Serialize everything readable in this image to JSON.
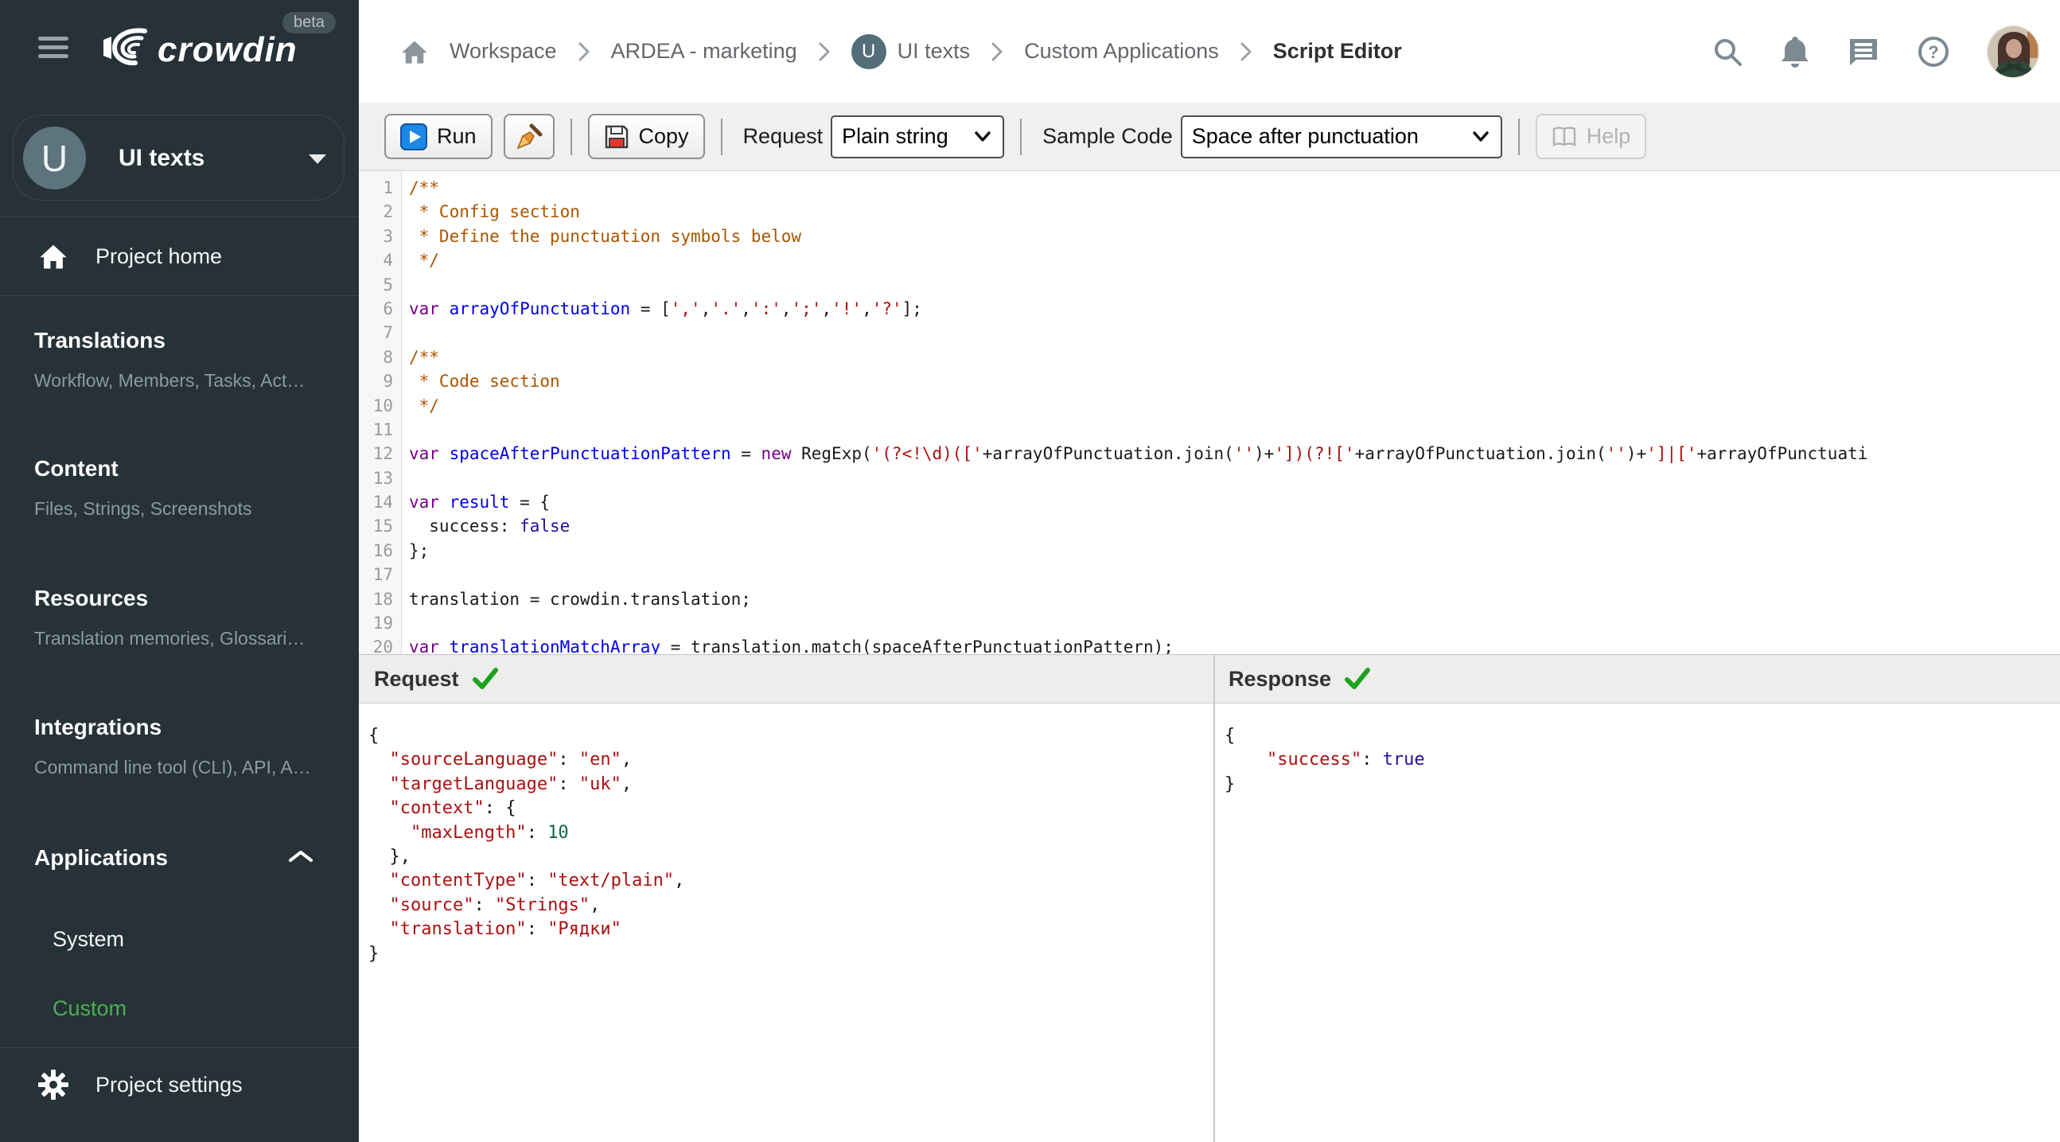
{
  "sidebar": {
    "logo_text": "crowdin",
    "beta_label": "beta",
    "project": {
      "initial": "U",
      "name": "UI texts"
    },
    "home_label": "Project home",
    "sections": [
      {
        "title": "Translations",
        "subtitle": "Workflow, Members, Tasks, Act…"
      },
      {
        "title": "Content",
        "subtitle": "Files, Strings, Screenshots"
      },
      {
        "title": "Resources",
        "subtitle": "Translation memories, Glossari…"
      },
      {
        "title": "Integrations",
        "subtitle": "Command line tool (CLI), API, A…"
      }
    ],
    "applications": {
      "title": "Applications",
      "items": [
        {
          "label": "System",
          "active": false
        },
        {
          "label": "Custom",
          "active": true
        }
      ]
    },
    "settings_label": "Project settings",
    "active_color": "#4caf50"
  },
  "breadcrumb": {
    "project_initial": "U",
    "items": [
      "Workspace",
      "ARDEA - marketing",
      "UI texts",
      "Custom Applications",
      "Script Editor"
    ]
  },
  "toolbar": {
    "run_label": "Run",
    "copy_label": "Copy",
    "request_label": "Request",
    "request_value": "Plain string",
    "sample_code_label": "Sample Code",
    "sample_code_value": "Space after punctuation",
    "help_label": "Help"
  },
  "editor": {
    "lines": [
      [
        [
          "c",
          "/**"
        ]
      ],
      [
        [
          "c",
          " * Config section"
        ]
      ],
      [
        [
          "c",
          " * Define the punctuation symbols below"
        ]
      ],
      [
        [
          "c",
          " */"
        ]
      ],
      [],
      [
        [
          "k",
          "var"
        ],
        [
          "p",
          " "
        ],
        [
          "d",
          "arrayOfPunctuation"
        ],
        [
          "p",
          " = ["
        ],
        [
          "s",
          "','"
        ],
        [
          "p",
          ","
        ],
        [
          "s",
          "'.'"
        ],
        [
          "p",
          ","
        ],
        [
          "s",
          "':'"
        ],
        [
          "p",
          ","
        ],
        [
          "s",
          "';'"
        ],
        [
          "p",
          ","
        ],
        [
          "s",
          "'!'"
        ],
        [
          "p",
          ","
        ],
        [
          "s",
          "'?'"
        ],
        [
          "p",
          "];"
        ]
      ],
      [],
      [
        [
          "c",
          "/**"
        ]
      ],
      [
        [
          "c",
          " * Code section"
        ]
      ],
      [
        [
          "c",
          " */"
        ]
      ],
      [],
      [
        [
          "k",
          "var"
        ],
        [
          "p",
          " "
        ],
        [
          "d",
          "spaceAfterPunctuationPattern"
        ],
        [
          "p",
          " = "
        ],
        [
          "k",
          "new"
        ],
        [
          "p",
          " RegExp("
        ],
        [
          "s",
          "'(?<!\\d)(['"
        ],
        [
          "p",
          "+arrayOfPunctuation.join("
        ],
        [
          "s",
          "''"
        ],
        [
          "p",
          ")+"
        ],
        [
          "s",
          "'])(?!['"
        ],
        [
          "p",
          "+arrayOfPunctuation.join("
        ],
        [
          "s",
          "''"
        ],
        [
          "p",
          ")+"
        ],
        [
          "s",
          "']|['"
        ],
        [
          "p",
          "+arrayOfPunctuati"
        ]
      ],
      [],
      [
        [
          "k",
          "var"
        ],
        [
          "p",
          " "
        ],
        [
          "d",
          "result"
        ],
        [
          "p",
          " = {"
        ]
      ],
      [
        [
          "p",
          "  success: "
        ],
        [
          "a",
          "false"
        ]
      ],
      [
        [
          "p",
          "};"
        ]
      ],
      [],
      [
        [
          "p",
          "translation = crowdin.translation;"
        ]
      ],
      [],
      [
        [
          "k",
          "var"
        ],
        [
          "p",
          " "
        ],
        [
          "d",
          "translationMatchArray"
        ],
        [
          "p",
          " = translation.match(spaceAfterPunctuationPattern);"
        ]
      ],
      []
    ]
  },
  "request_panel": {
    "title": "Request",
    "status": "success",
    "lines": [
      [
        [
          "p",
          "{"
        ]
      ],
      [
        [
          "s",
          "  \"sourceLanguage\""
        ],
        [
          "p",
          ": "
        ],
        [
          "s",
          "\"en\""
        ],
        [
          "p",
          ","
        ]
      ],
      [
        [
          "s",
          "  \"targetLanguage\""
        ],
        [
          "p",
          ": "
        ],
        [
          "s",
          "\"uk\""
        ],
        [
          "p",
          ","
        ]
      ],
      [
        [
          "s",
          "  \"context\""
        ],
        [
          "p",
          ": {"
        ]
      ],
      [
        [
          "s",
          "    \"maxLength\""
        ],
        [
          "p",
          ": "
        ],
        [
          "n",
          "10"
        ]
      ],
      [
        [
          "p",
          "  },"
        ]
      ],
      [
        [
          "s",
          "  \"contentType\""
        ],
        [
          "p",
          ": "
        ],
        [
          "s",
          "\"text/plain\""
        ],
        [
          "p",
          ","
        ]
      ],
      [
        [
          "s",
          "  \"source\""
        ],
        [
          "p",
          ": "
        ],
        [
          "s",
          "\"Strings\""
        ],
        [
          "p",
          ","
        ]
      ],
      [
        [
          "s",
          "  \"translation\""
        ],
        [
          "p",
          ": "
        ],
        [
          "s",
          "\"Рядки\""
        ]
      ],
      [
        [
          "p",
          "}"
        ]
      ]
    ]
  },
  "response_panel": {
    "title": "Response",
    "status": "success",
    "lines": [
      [
        [
          "p",
          "{"
        ]
      ],
      [
        [
          "s",
          "    \"success\""
        ],
        [
          "p",
          ": "
        ],
        [
          "a",
          "true"
        ]
      ],
      [
        [
          "p",
          "}"
        ]
      ]
    ]
  }
}
